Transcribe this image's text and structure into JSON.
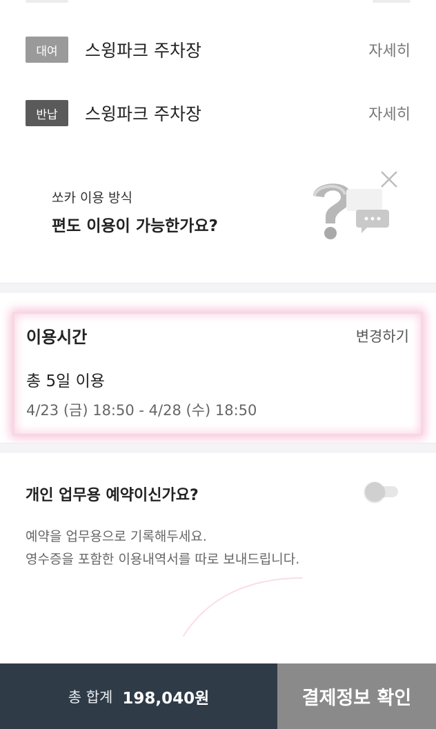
{
  "locations": [
    {
      "badge": "대여",
      "name": "스윙파크 주차장",
      "detail": "자세히"
    },
    {
      "badge": "반납",
      "name": "스윙파크 주차장",
      "detail": "자세히"
    }
  ],
  "info_card": {
    "subtitle": "쏘카 이용 방식",
    "title": "편도 이용이 가능한가요?",
    "close_icon": "close-icon",
    "illustration_icon": "question-chat-icon"
  },
  "usage_time": {
    "title": "이용시간",
    "change_label": "변경하기",
    "total": "총 5일 이용",
    "range": "4/23 (금) 18:50 - 4/28 (수) 18:50"
  },
  "business": {
    "title": "개인 업무용 예약이신가요?",
    "toggle_on": false,
    "desc_line1": "예약을 업무용으로 기록해두세요.",
    "desc_line2": "영수증을 포함한 이용내역서를 따로 보내드립니다."
  },
  "footer": {
    "total_label": "총 합계",
    "total_amount": "198,040원",
    "confirm_label": "결제정보 확인"
  },
  "colors": {
    "footer_dark": "#2f3b47",
    "confirm_gray": "#8a8a8a",
    "highlight_pink": "#f9c8dc"
  }
}
